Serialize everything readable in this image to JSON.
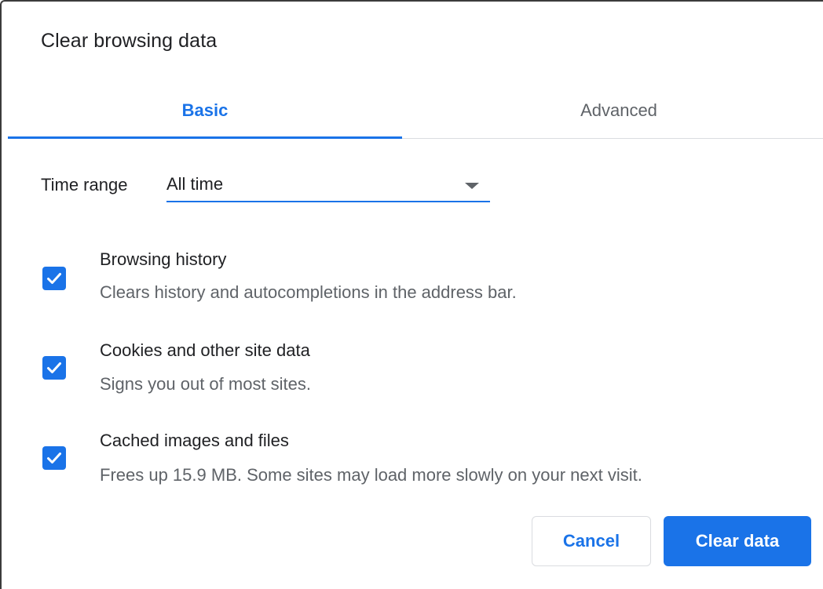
{
  "dialog": {
    "title": "Clear browsing data"
  },
  "tabs": [
    {
      "label": "Basic",
      "selected": true
    },
    {
      "label": "Advanced",
      "selected": false
    }
  ],
  "time_range": {
    "label": "Time range",
    "value": "All time"
  },
  "options": [
    {
      "title": "Browsing history",
      "description": "Clears history and autocompletions in the address bar.",
      "checked": true
    },
    {
      "title": "Cookies and other site data",
      "description": "Signs you out of most sites.",
      "checked": true
    },
    {
      "title": "Cached images and files",
      "description": "Frees up 15.9 MB. Some sites may load more slowly on your next visit.",
      "checked": true
    }
  ],
  "buttons": {
    "cancel": "Cancel",
    "clear": "Clear data"
  },
  "colors": {
    "accent": "#1a73e8",
    "text_primary": "#202124",
    "text_secondary": "#5f6368",
    "divider": "#dadce0"
  },
  "icons": {
    "checkbox_mark": "check-icon",
    "dropdown": "dropdown-arrow-icon"
  }
}
